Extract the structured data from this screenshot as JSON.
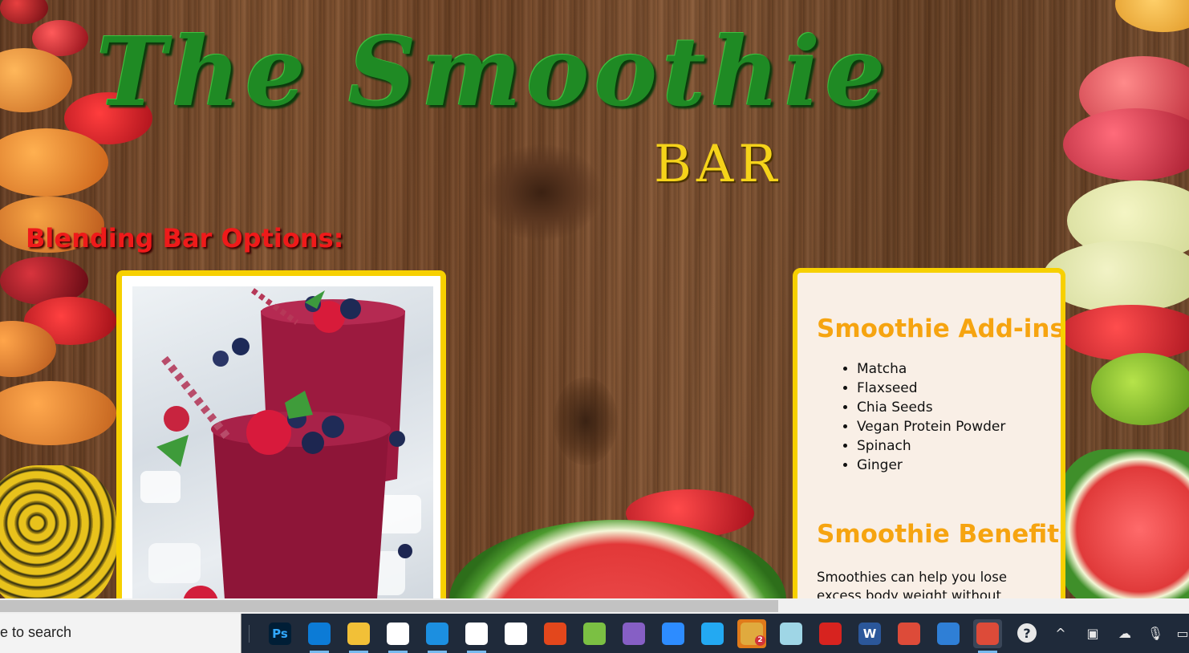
{
  "page": {
    "title": "The Smoothie",
    "subtitle": "BAR",
    "section_heading": "Blending Bar Options:"
  },
  "info_card": {
    "addins_title": "Smoothie Add-ins",
    "addins": [
      "Matcha",
      "Flaxseed",
      "Chia Seeds",
      "Vegan Protein Powder",
      "Spinach",
      "Ginger"
    ],
    "benefits_title": "Smoothie Benefits",
    "benefits_text": "Smoothies can help you lose excess body weight without skipping any"
  },
  "taskbar": {
    "search_placeholder": "e to search",
    "apps": [
      {
        "name": "photoshop-icon",
        "label": "Ps",
        "color": "#001e36",
        "fg": "#31a8ff"
      },
      {
        "name": "edge-icon",
        "label": "",
        "color": "#0c7bd6"
      },
      {
        "name": "file-explorer-icon",
        "label": "",
        "color": "#f2c037"
      },
      {
        "name": "microsoft-store-icon",
        "label": "",
        "color": "#ffffff"
      },
      {
        "name": "mail-icon",
        "label": "",
        "color": "#1c8fe0"
      },
      {
        "name": "dropbox-icon",
        "label": "",
        "color": "#ffffff"
      },
      {
        "name": "github-desktop-icon",
        "label": "",
        "color": "#ffffff"
      },
      {
        "name": "office-icon",
        "label": "",
        "color": "#e3471c"
      },
      {
        "name": "sourcetree-icon",
        "label": "",
        "color": "#7bc043"
      },
      {
        "name": "visual-studio-icon",
        "label": "",
        "color": "#865fc5"
      },
      {
        "name": "zoom-icon",
        "label": "",
        "color": "#2d8cff"
      },
      {
        "name": "vscode-icon",
        "label": "",
        "color": "#23a9f2"
      },
      {
        "name": "slack-icon",
        "label": "",
        "color": "#e0aa3e",
        "badge": "2"
      },
      {
        "name": "notes-icon",
        "label": "",
        "color": "#9fd6e6"
      },
      {
        "name": "acrobat-icon",
        "label": "",
        "color": "#d7231f"
      },
      {
        "name": "word-icon",
        "label": "W",
        "color": "#2b579a"
      },
      {
        "name": "chrome-icon",
        "label": "",
        "color": "#dd4b39"
      },
      {
        "name": "photos-icon",
        "label": "",
        "color": "#2f7fd6"
      },
      {
        "name": "chrome-active-icon",
        "label": "",
        "color": "#dd4b39"
      }
    ],
    "tray": [
      {
        "name": "help-icon",
        "glyph": "?"
      },
      {
        "name": "show-hidden-icons-chevron-icon",
        "glyph": "^"
      },
      {
        "name": "meet-now-icon",
        "glyph": "▣"
      },
      {
        "name": "onedrive-icon",
        "glyph": "☁"
      },
      {
        "name": "microphone-icon",
        "glyph": "🎙"
      },
      {
        "name": "network-icon",
        "glyph": "▭"
      }
    ]
  }
}
